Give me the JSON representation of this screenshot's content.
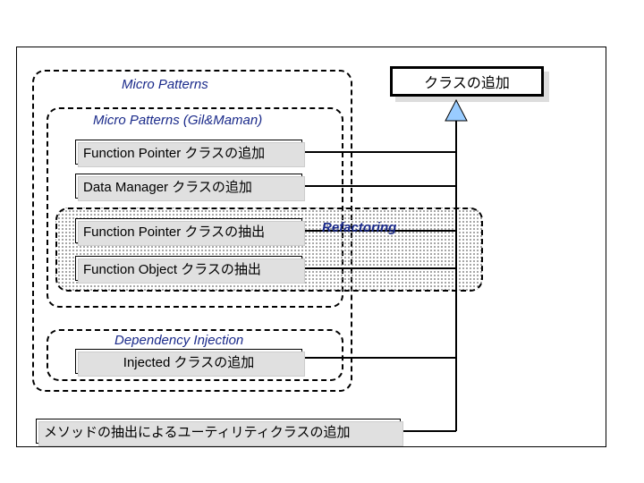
{
  "top_class": "クラスの追加",
  "micro_patterns_title": "Micro Patterns",
  "gil_maman_title": "Micro Patterns (Gil&Maman)",
  "refactoring_title": "Refactoring",
  "dependency_injection_title": "Dependency Injection",
  "boxes": {
    "fp_add": "Function Pointer クラスの追加",
    "dm_add": "Data Manager クラスの追加",
    "fp_extract": "Function Pointer クラスの抽出",
    "fo_extract": "Function Object クラスの抽出",
    "injected": "Injected クラスの追加",
    "utility": "メソッドの抽出によるユーティリティクラスの追加"
  }
}
